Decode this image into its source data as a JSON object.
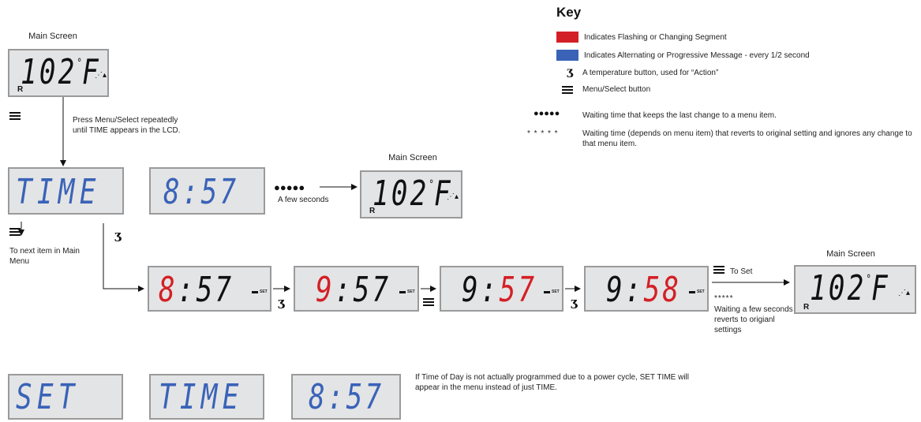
{
  "main_screen_label": "Main Screen",
  "main_temp": "102",
  "main_unit": "F",
  "r_indicator": "R",
  "time_word": "TIME",
  "set_word": "SET",
  "time_value": "8:57",
  "step1": {
    "hour": "8",
    "colon": ":",
    "minutes": "57"
  },
  "step2": {
    "hour": "9",
    "colon": ":",
    "minutes": "57"
  },
  "step3": {
    "hour": "9",
    "colon": ":",
    "minutes": "57"
  },
  "step4": {
    "hour": "9",
    "colon": ":",
    "minutes": "58"
  },
  "set_tag": "SET",
  "instruction_press": "Press Menu/Select repeatedly until TIME appears in the LCD.",
  "to_next_item": "To next item in Main Menu",
  "a_few_seconds": "A few seconds",
  "to_set": "To Set",
  "five_stars": "*****",
  "waiting_revert": "Waiting a few seconds reverts to origianl settings",
  "five_dots": "●●●●●",
  "power_cycle_note": "If Time of Day is not actually programmed due to a power cycle, SET TIME will appear in the menu instead of just TIME.",
  "key": {
    "title": "Key",
    "flashing": "Indicates Flashing or Changing Segment",
    "alternating": "Indicates Alternating or Progressive Message - every 1/2 second",
    "temp_button": "A temperature button, used for “Action”",
    "menu_button": "Menu/Select button",
    "dots_symbol": "●●●●●",
    "dots_desc": "Waiting time that keeps the last change to a menu item.",
    "stars_symbol": "* * * * *",
    "stars_desc": "Waiting time (depends on menu item) that reverts to original setting and ignores any change to that menu item.",
    "colors": {
      "red": "#d32026",
      "blue": "#3a63b8"
    }
  },
  "icons": {
    "temp_button": "temperature-button-icon",
    "menu_button": "menu-select-icon",
    "heater": "heater-icon"
  }
}
